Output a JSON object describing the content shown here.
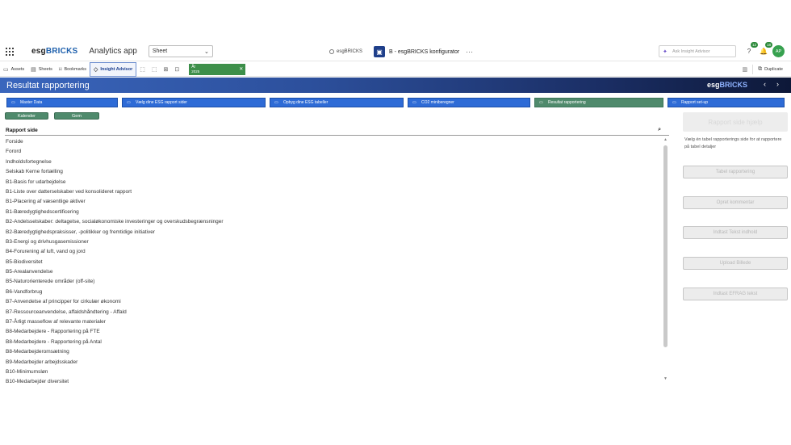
{
  "topbar": {
    "logo_prefix": "esg",
    "logo_bold": "BRICKS",
    "app_name": "Analytics app",
    "sheet_select": "Sheet",
    "user_label": "esgBRICKS",
    "app_title": "B - esgBRICKS konfigurator",
    "more": "···",
    "ask_placeholder": "Ask Insight Advisor",
    "help_badge": "12",
    "notif_badge": "18",
    "avatar_initials": "AP"
  },
  "toolbar": {
    "assets": "Assets",
    "sheets": "Sheets",
    "bookmarks": "Bookmarks",
    "insight_advisor": "Insight Advisor",
    "selection_label": "År",
    "selection_value": "2025",
    "duplicate": "Duplicate"
  },
  "banner": {
    "title": "Resultat rapportering",
    "logo_prefix": "esg",
    "logo_bold": "BRICKS",
    "prev": "‹",
    "next": "›"
  },
  "nav": [
    {
      "label": "Master Data"
    },
    {
      "label": "Vælg dine ESG rapport sider"
    },
    {
      "label": "Opbyg dine ESG tabeller"
    },
    {
      "label": "CO2 miniberegner"
    },
    {
      "label": "Resultat rapportering"
    },
    {
      "label": "Rapport set-up"
    }
  ],
  "actions": {
    "kalender": "Kalender",
    "gem": "Gem"
  },
  "table": {
    "header": "Rapport side",
    "rows": [
      "Forside",
      "Forord",
      "Indholdsfortegnelse",
      "Selskab Kerne fortælling",
      "B1-Basis for udarbejdelse",
      "B1-Liste over datterselskaber ved konsolideret rapport",
      "B1-Placering af væsentlige aktiver",
      "B1-Bæredygtighedscertificering",
      "B2-Andelsselskaber: deltagelse, socialøkonomiske investeringer og overskudsbegrænsninger",
      "B2-Bæredygtighedspraksisser, -politikker og fremtidige initiativer",
      "B3-Energi og drivhusgasemissioner",
      "B4-Forurening af luft, vand og jord",
      "B5-Biodiversitet",
      "B5-Arealanvendelse",
      "B5-Naturorienterede områder (off-site)",
      "B6-Vandforbrug",
      "B7-Anvendelse af principper for cirkulær økonomi",
      "B7-Ressourceanvendelse, affaldshåndtering - Affald",
      "B7-Årligt masseflow af relevante materialer",
      "B8-Medarbejdere - Rapportering på FTE",
      "B8-Medarbejdere - Rapportering på Antal",
      "B8-Medarbejderomsætning",
      "B9-Medarbejder arbejdsskader",
      "B10-Minimumsløn",
      "B10-Medarbejder diversitet"
    ]
  },
  "right_panel": {
    "main_button": "Rapport side hjælp",
    "help_text": "Vælg én tabel rapporterings side for at rapportere på tabel detaljer",
    "buttons": [
      "Tabel rapportering",
      "Opret kommentar",
      "Indtast Tekst indhold",
      "Upload Billede",
      "Indtast EFRAG tekst"
    ]
  }
}
